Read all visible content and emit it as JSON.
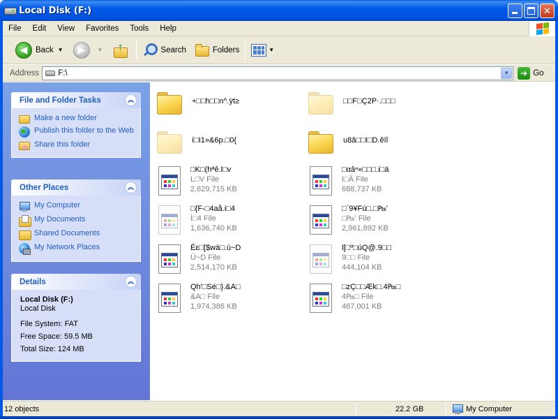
{
  "window": {
    "title": "Local Disk (F:)"
  },
  "menu": [
    "File",
    "Edit",
    "View",
    "Favorites",
    "Tools",
    "Help"
  ],
  "toolbar": {
    "back": "Back",
    "search": "Search",
    "folders": "Folders"
  },
  "address": {
    "label": "Address",
    "value": "F:\\",
    "go": "Go"
  },
  "tasks": {
    "file_folder": {
      "header": "File and Folder Tasks",
      "items": [
        "Make a new folder",
        "Publish this folder to the Web",
        "Share this folder"
      ]
    },
    "other_places": {
      "header": "Other Places",
      "items": [
        "My Computer",
        "My Documents",
        "Shared Documents",
        "My Network Places"
      ]
    },
    "details": {
      "header": "Details",
      "name": "Local Disk (F:)",
      "type": "Local Disk",
      "filesystem": "File System: FAT",
      "free": "Free Space: 59.5 MB",
      "total": "Total Size: 124 MB"
    }
  },
  "folders": [
    {
      "name": "+□□h□□n^.ÿt≥",
      "faded": false
    },
    {
      "name": "□□F□Ç2P·.□□□",
      "faded": true
    },
    {
      "name": "í□I1»&6p.□0{",
      "faded": true
    },
    {
      "name": "u8â□□I□D.êïî",
      "faded": false
    }
  ],
  "files": [
    {
      "name": "□K□(hªê.l□v",
      "type": "L□V File",
      "size": "2,629,715 KB",
      "faded": false
    },
    {
      "name": "□αâⁿ»□□□.i□ä",
      "type": "I□Ä File",
      "size": "688,737 KB",
      "faded": false
    },
    {
      "name": "□{F-□4aå.i□4",
      "type": "Ì□4 File",
      "size": "1,636,740 KB",
      "faded": true
    },
    {
      "name": "□`9¥Fú□.□₧'",
      "type": "□₧' File",
      "size": "2,961,892 KB",
      "faded": false
    },
    {
      "name": "Éε□[$wá□.ú~D",
      "type": "Ú~D File",
      "size": "2,514,170 KB",
      "faded": false
    },
    {
      "name": "l[□º□úQ@.9□□",
      "type": "9□□ File",
      "size": "444,104 KB",
      "faded": true
    },
    {
      "name": "Qh'□Sé□}.&A□",
      "type": "&A□ File",
      "size": "1,974,386 KB",
      "faded": false
    },
    {
      "name": "□zÇ□□Æk□.4₧□",
      "type": "4₧□ File",
      "size": "467,001 KB",
      "faded": false
    }
  ],
  "status": {
    "objects": "12 objects",
    "size": "22.2 GB",
    "location": "My Computer"
  }
}
